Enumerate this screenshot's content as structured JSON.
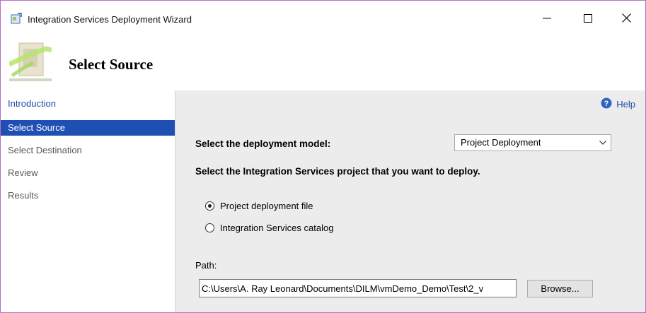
{
  "window": {
    "title": "Integration Services Deployment Wizard",
    "controls": {
      "minimize_icon": "minimize-icon",
      "maximize_icon": "maximize-icon",
      "close_icon": "close-icon"
    }
  },
  "header": {
    "page_title": "Select Source"
  },
  "sidebar": {
    "items": [
      {
        "label": "Introduction",
        "state": "link"
      },
      {
        "label": "Select Source",
        "state": "selected"
      },
      {
        "label": "Select Destination",
        "state": "normal"
      },
      {
        "label": "Review",
        "state": "normal"
      },
      {
        "label": "Results",
        "state": "normal"
      }
    ]
  },
  "main": {
    "help_label": "Help",
    "deployment_model_label": "Select the deployment model:",
    "deployment_model_value": "Project Deployment",
    "project_prompt": "Select the Integration Services project that you want to deploy.",
    "radios": [
      {
        "label": "Project deployment file",
        "checked": true
      },
      {
        "label": "Integration Services catalog",
        "checked": false
      }
    ],
    "path_label": "Path:",
    "path_value": "C:\\Users\\A. Ray Leonard\\Documents\\DILM\\vmDemo_Demo\\Test\\2_v",
    "browse_label": "Browse..."
  },
  "colors": {
    "selection": "#1e4fb3",
    "link": "#1e4aa8",
    "panel": "#ececec",
    "border": "#b56fc9"
  }
}
